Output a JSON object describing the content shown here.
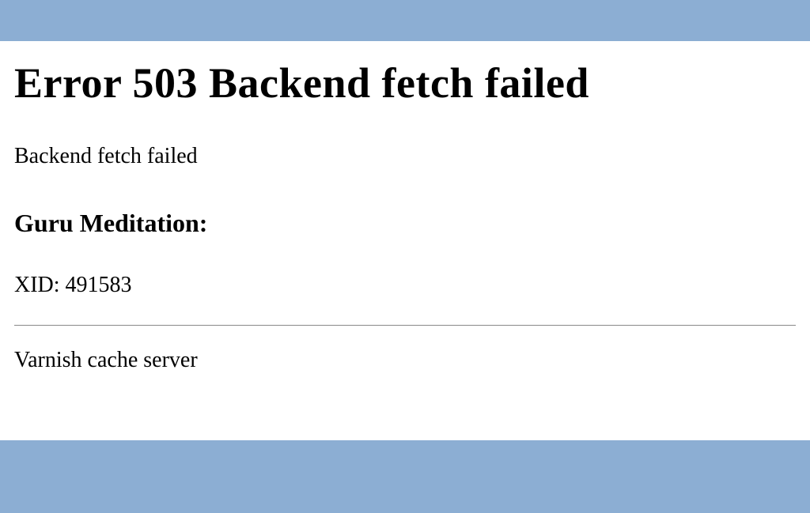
{
  "error": {
    "title": "Error 503 Backend fetch failed",
    "message": "Backend fetch failed",
    "guru_heading": "Guru Meditation:",
    "xid_label": "XID: 491583",
    "server": "Varnish cache server"
  }
}
